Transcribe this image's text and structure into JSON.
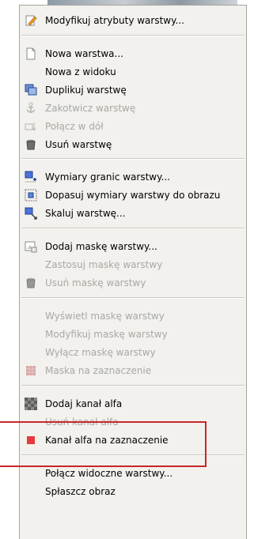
{
  "menu": {
    "items": [
      {
        "id": "edit-attributes",
        "label": "Modyfikuj atrybuty warstwy...",
        "enabled": true,
        "icon": "edit-icon"
      },
      {
        "id": "new-layer",
        "label": "Nowa warstwa...",
        "enabled": true,
        "icon": "new-layer-icon"
      },
      {
        "id": "new-from-visible",
        "label": "Nowa z widoku",
        "enabled": true,
        "icon": ""
      },
      {
        "id": "duplicate-layer",
        "label": "Duplikuj warstwę",
        "enabled": true,
        "icon": "duplicate-icon"
      },
      {
        "id": "anchor-layer",
        "label": "Zakotwicz warstwę",
        "enabled": false,
        "icon": "anchor-icon"
      },
      {
        "id": "merge-down",
        "label": "Połącz w dół",
        "enabled": false,
        "icon": "merge-down-icon"
      },
      {
        "id": "delete-layer",
        "label": "Usuń warstwę",
        "enabled": true,
        "icon": "trash-icon"
      },
      {
        "id": "layer-boundary-size",
        "label": "Wymiary granic warstwy...",
        "enabled": true,
        "icon": "boundary-size-icon"
      },
      {
        "id": "layer-to-image-size",
        "label": "Dopasuj wymiary warstwy do obrazu",
        "enabled": true,
        "icon": "fit-to-image-icon"
      },
      {
        "id": "scale-layer",
        "label": "Skaluj warstwę...",
        "enabled": true,
        "icon": "scale-icon"
      },
      {
        "id": "add-layer-mask",
        "label": "Dodaj maskę warstwy...",
        "enabled": true,
        "icon": "layer-mask-icon"
      },
      {
        "id": "apply-layer-mask",
        "label": "Zastosuj maskę warstwy",
        "enabled": false,
        "icon": ""
      },
      {
        "id": "delete-layer-mask",
        "label": "Usuń maskę warstwy",
        "enabled": false,
        "icon": "trash-icon"
      },
      {
        "id": "show-layer-mask",
        "label": "Wyświetl maskę warstwy",
        "enabled": false,
        "icon": ""
      },
      {
        "id": "edit-layer-mask",
        "label": "Modyfikuj maskę warstwy",
        "enabled": false,
        "icon": ""
      },
      {
        "id": "disable-layer-mask",
        "label": "Wyłącz maskę warstwy",
        "enabled": false,
        "icon": ""
      },
      {
        "id": "mask-to-selection",
        "label": "Maska na zaznaczenie",
        "enabled": false,
        "icon": "mask-selection-icon"
      },
      {
        "id": "add-alpha-channel",
        "label": "Dodaj kanał alfa",
        "enabled": true,
        "icon": "alpha-checker-icon"
      },
      {
        "id": "remove-alpha-channel",
        "label": "Usuń kanał alfa",
        "enabled": false,
        "icon": ""
      },
      {
        "id": "alpha-to-selection",
        "label": "Kanał alfa na zaznaczenie",
        "enabled": true,
        "icon": "alpha-selection-icon"
      },
      {
        "id": "merge-visible",
        "label": "Połącz widoczne warstwy...",
        "enabled": true,
        "icon": ""
      },
      {
        "id": "flatten-image",
        "label": "Spłaszcz obraz",
        "enabled": true,
        "icon": ""
      }
    ]
  },
  "colors": {
    "menu_bg": "#f2f1ed",
    "disabled_text": "#a8a8a4",
    "highlight_border": "#c8262a"
  }
}
